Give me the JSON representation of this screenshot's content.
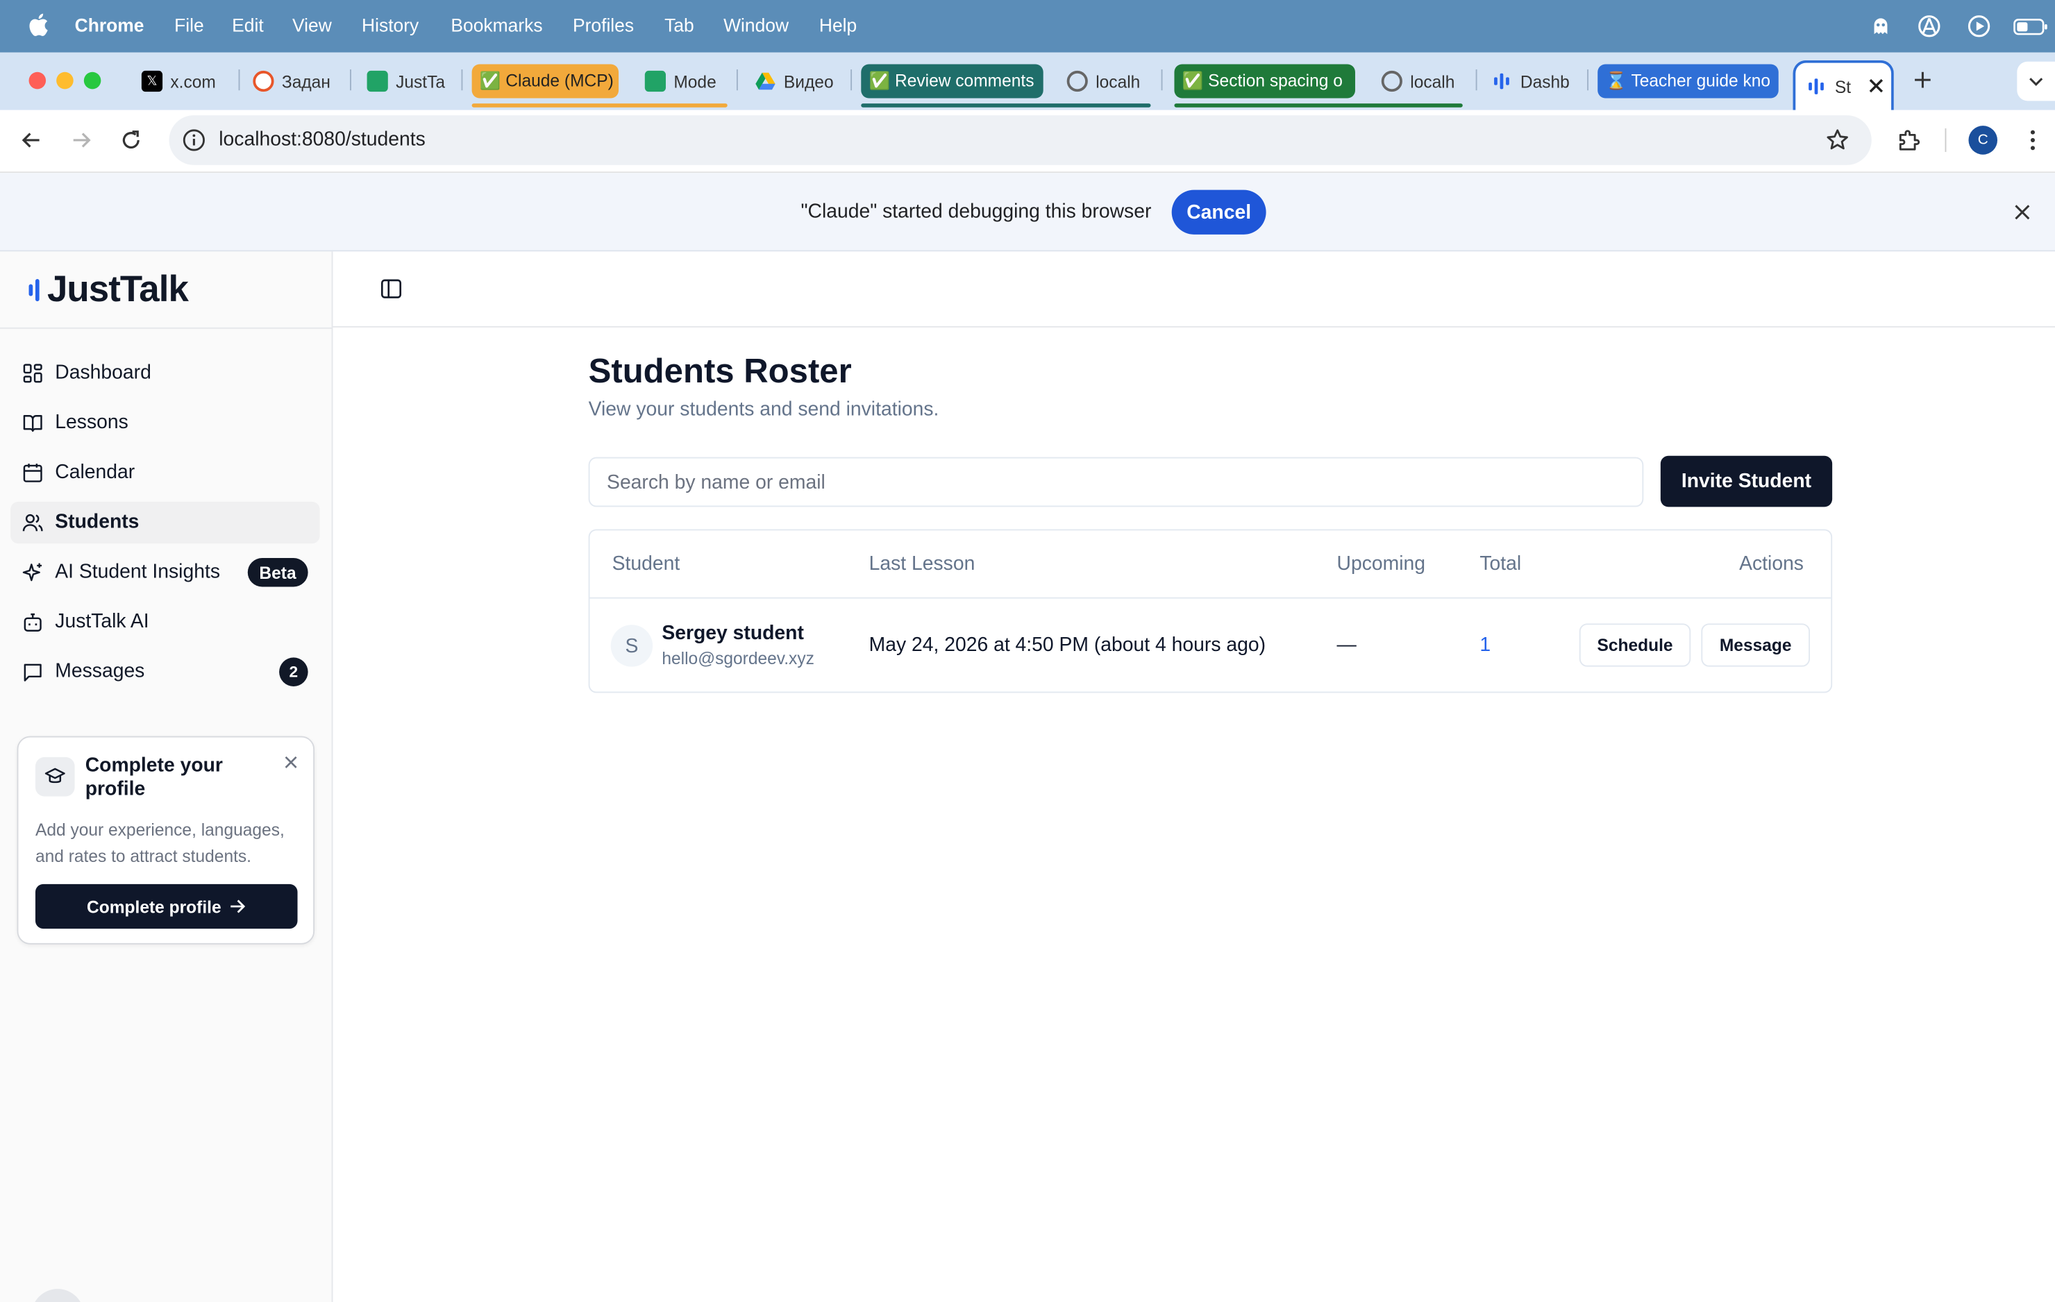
{
  "menubar": {
    "app": "Chrome",
    "items": [
      "File",
      "Edit",
      "View",
      "History",
      "Bookmarks",
      "Profiles",
      "Tab",
      "Window",
      "Help"
    ]
  },
  "tabs": [
    {
      "label": "x.com",
      "icon": "x-logo-icon"
    },
    {
      "label": "Задан",
      "icon": "orange-circle-icon"
    },
    {
      "label": "JustTa",
      "icon": "green-slides-icon"
    },
    {
      "label": "✅ Claude (MCP)",
      "icon": "",
      "group_color": "#f2a93b"
    },
    {
      "label": "Mode",
      "icon": "green-slides-icon"
    },
    {
      "label": "Видео",
      "icon": "google-drive-icon"
    },
    {
      "label": "✅ Review comments",
      "icon": "",
      "group_color": "#1f6e6a"
    },
    {
      "label": "localh",
      "icon": "globe-icon"
    },
    {
      "label": "✅ Section spacing o",
      "icon": "",
      "group_color": "#1f7a3a"
    },
    {
      "label": "localh",
      "icon": "globe-icon"
    },
    {
      "label": "Dashb",
      "icon": "justtalk-icon"
    },
    {
      "label": "⌛ Teacher guide kno",
      "icon": "",
      "group_color": "#2f6fd6"
    },
    {
      "label": "St",
      "icon": "justtalk-icon",
      "active": true
    }
  ],
  "toolbar": {
    "url": "localhost:8080/students",
    "profile_initial": "C"
  },
  "infobar": {
    "message": "\"Claude\" started debugging this browser",
    "cancel_label": "Cancel"
  },
  "sidebar": {
    "brand": "JustTalk",
    "items": [
      {
        "label": "Dashboard",
        "icon": "dashboard-icon"
      },
      {
        "label": "Lessons",
        "icon": "book-icon"
      },
      {
        "label": "Calendar",
        "icon": "calendar-icon"
      },
      {
        "label": "Students",
        "icon": "users-icon",
        "active": true
      },
      {
        "label": "AI Student Insights",
        "icon": "sparkles-icon",
        "badge": "Beta"
      },
      {
        "label": "JustTalk AI",
        "icon": "bot-icon"
      },
      {
        "label": "Messages",
        "icon": "message-icon",
        "count": "2"
      }
    ],
    "profile_card": {
      "title": "Complete your profile",
      "description": "Add your experience, languages, and rates to attract students.",
      "button_label": "Complete profile"
    }
  },
  "main": {
    "title": "Students Roster",
    "subtitle": "View your students and send invitations.",
    "search_placeholder": "Search by name or email",
    "invite_label": "Invite Student",
    "table": {
      "headers": [
        "Student",
        "Last Lesson",
        "Upcoming",
        "Total",
        "Actions"
      ],
      "rows": [
        {
          "initial": "S",
          "name": "Sergey student",
          "email": "hello@sgordeev.xyz",
          "last_lesson": "May 24, 2026 at 4:50 PM (about 4 hours ago)",
          "upcoming": "—",
          "total": "1",
          "actions": [
            "Schedule",
            "Message"
          ]
        }
      ]
    }
  },
  "colors": {
    "menubar": "#5b8db8",
    "tabstrip": "#d4e3f4",
    "accent": "#2563eb",
    "dark": "#0f172a",
    "cancel_button": "#1f56d8"
  }
}
